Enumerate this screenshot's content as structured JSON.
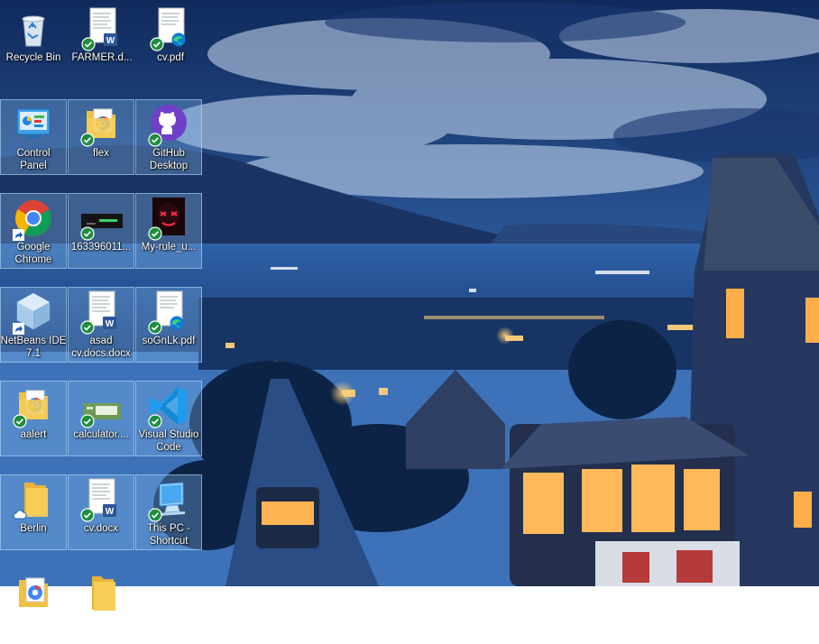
{
  "desktop": {
    "icons": [
      {
        "label": "Recycle Bin",
        "icon": "recycle-bin-icon",
        "badge": "none"
      },
      {
        "label": "FARMER.d...",
        "icon": "word-document-icon",
        "badge": "synced"
      },
      {
        "label": "cv.pdf",
        "icon": "pdf-edge-icon",
        "badge": "synced"
      },
      {
        "label": "Control\nPanel",
        "icon": "control-panel-icon",
        "badge": "none"
      },
      {
        "label": "flex",
        "icon": "folder-chrome-icon",
        "badge": "synced"
      },
      {
        "label": "GitHub\nDesktop",
        "icon": "github-desktop-icon",
        "badge": "synced"
      },
      {
        "label": "Google\nChrome",
        "icon": "chrome-icon",
        "badge": "shortcut"
      },
      {
        "label": "163396011...",
        "icon": "image-thumbnail-icon",
        "badge": "synced"
      },
      {
        "label": "My-rule_u...",
        "icon": "red-mask-image-icon",
        "badge": "synced"
      },
      {
        "label": "NetBeans IDE\n7.1",
        "icon": "netbeans-icon",
        "badge": "shortcut"
      },
      {
        "label": "asad\ncv.docs.docx",
        "icon": "word-document-icon",
        "badge": "synced"
      },
      {
        "label": "soGnLk.pdf",
        "icon": "pdf-edge-icon",
        "badge": "synced"
      },
      {
        "label": "aalert",
        "icon": "folder-chrome-icon",
        "badge": "synced"
      },
      {
        "label": "calculator....",
        "icon": "calculator-image-icon",
        "badge": "synced"
      },
      {
        "label": "Visual Studio\nCode",
        "icon": "vscode-icon",
        "badge": "synced"
      },
      {
        "label": "Berlin",
        "icon": "folder-cloud-icon",
        "badge": "cloud"
      },
      {
        "label": "cv.docx",
        "icon": "word-document-icon",
        "badge": "synced"
      },
      {
        "label": "This PC -\nShortcut",
        "icon": "this-pc-icon",
        "badge": "synced"
      }
    ]
  },
  "colors": {
    "sky": "#1c3d75",
    "water": "#2f62a8",
    "sync_green": "#1e8e3e",
    "selection": "#87bef0"
  }
}
